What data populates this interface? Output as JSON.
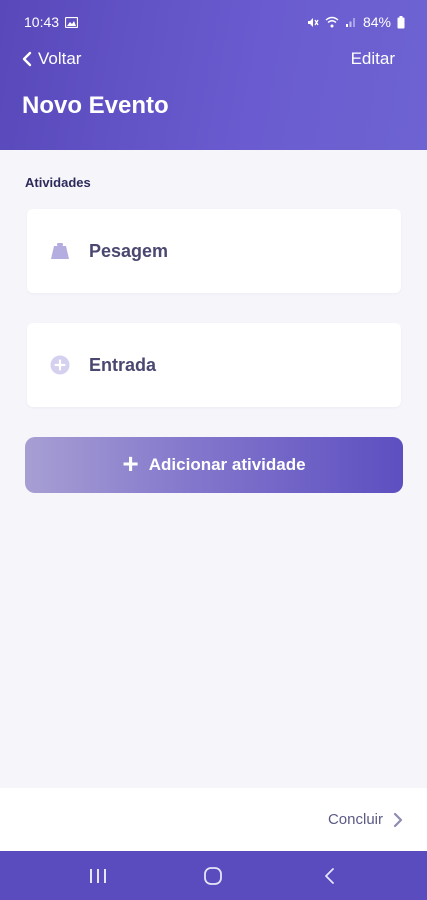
{
  "status_bar": {
    "time": "10:43",
    "battery": "84%"
  },
  "header": {
    "back_label": "Voltar",
    "edit_label": "Editar",
    "title": "Novo Evento"
  },
  "section": {
    "label": "Atividades"
  },
  "activities": [
    {
      "label": "Pesagem",
      "icon": "scale-icon"
    },
    {
      "label": "Entrada",
      "icon": "plus-circle-icon"
    }
  ],
  "add_button": {
    "label": "Adicionar atividade"
  },
  "footer": {
    "conclude_label": "Concluir"
  },
  "colors": {
    "header": "#5848ba",
    "accent": "#5d4fc0",
    "background": "#f5f5fa",
    "nav_bar": "#5a4bbf"
  }
}
